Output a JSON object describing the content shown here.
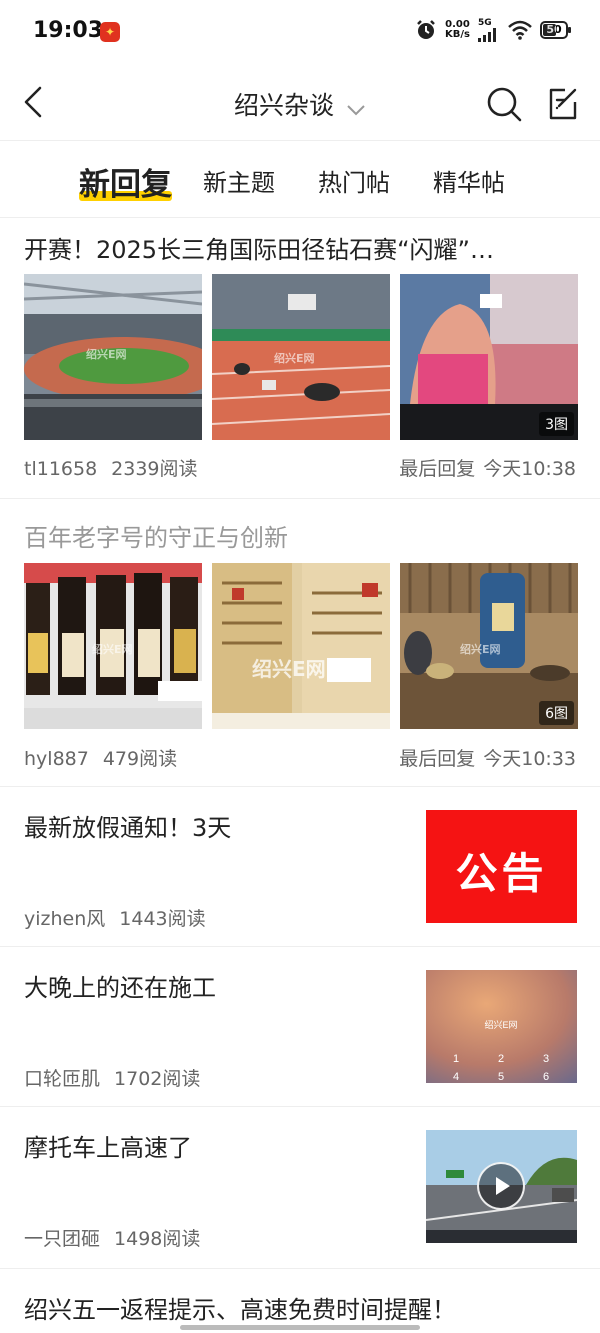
{
  "status_bar": {
    "time": "19:03",
    "net_speed_value": "0.00",
    "net_speed_unit": "KB/s",
    "network": "5G",
    "battery": "50"
  },
  "header": {
    "title": "绍兴杂谈"
  },
  "tabs": [
    {
      "label": "新回复",
      "active": true
    },
    {
      "label": "新主题",
      "active": false
    },
    {
      "label": "热门帖",
      "active": false
    },
    {
      "label": "精华帖",
      "active": false
    }
  ],
  "posts": [
    {
      "title": "开赛！2025长三角国际田径钻石赛“闪耀”…",
      "author": "tl11658",
      "reads": "2339阅读",
      "last_reply_label": "最后回复",
      "last_reply_time": "今天10:38",
      "image_count": "3图"
    },
    {
      "title": "百年老字号的守正与创新",
      "author": "hyl887",
      "reads": "479阅读",
      "last_reply_label": "最后回复",
      "last_reply_time": "今天10:33",
      "image_count": "6图"
    },
    {
      "title": "最新放假通知！3天",
      "author": "yizhen风",
      "reads": "1443阅读",
      "thumb_text": "公告"
    },
    {
      "title": "大晚上的还在施工",
      "author": "口轮匝肌",
      "reads": "1702阅读"
    },
    {
      "title": "摩托车上高速了",
      "author": "一只团砸",
      "reads": "1498阅读"
    },
    {
      "title": "绍兴五一返程提示、高速免费时间提醒！"
    }
  ],
  "colors": {
    "accent": "#ffd000",
    "text": "#222222",
    "meta": "#666666"
  }
}
